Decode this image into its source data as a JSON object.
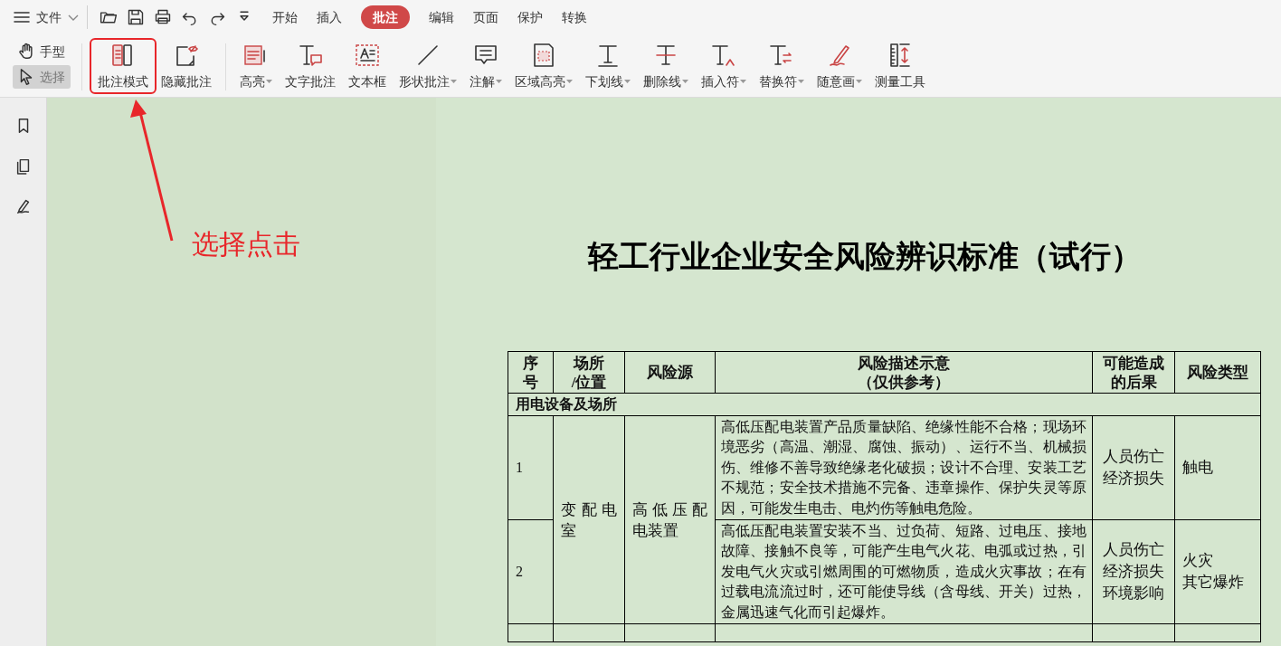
{
  "menu": {
    "label": "文件"
  },
  "tabs": [
    {
      "label": "开始",
      "selected": false
    },
    {
      "label": "插入",
      "selected": false
    },
    {
      "label": "批注",
      "selected": true
    },
    {
      "label": "编辑",
      "selected": false
    },
    {
      "label": "页面",
      "selected": false
    },
    {
      "label": "保护",
      "selected": false
    },
    {
      "label": "转换",
      "selected": false
    }
  ],
  "pointer_tools": [
    {
      "kind": "hand",
      "label": "手型",
      "selected": false
    },
    {
      "kind": "select",
      "label": "选择",
      "selected": true
    }
  ],
  "tools": [
    {
      "kind": "mode",
      "label": "批注模式",
      "dropdown": false,
      "outlined": true
    },
    {
      "kind": "hide",
      "label": "隐藏批注",
      "dropdown": false,
      "outlined": false
    },
    {
      "kind": "highlight",
      "label": "高亮",
      "dropdown": true,
      "outlined": false
    },
    {
      "kind": "textnote",
      "label": "文字批注",
      "dropdown": false,
      "outlined": false
    },
    {
      "kind": "textbox",
      "label": "文本框",
      "dropdown": false,
      "outlined": false
    },
    {
      "kind": "shape",
      "label": "形状批注",
      "dropdown": true,
      "outlined": false
    },
    {
      "kind": "note",
      "label": "注解",
      "dropdown": true,
      "outlined": false
    },
    {
      "kind": "area",
      "label": "区域高亮",
      "dropdown": true,
      "outlined": false
    },
    {
      "kind": "underline",
      "label": "下划线",
      "dropdown": true,
      "outlined": false
    },
    {
      "kind": "strike",
      "label": "删除线",
      "dropdown": true,
      "outlined": false
    },
    {
      "kind": "insert",
      "label": "插入符",
      "dropdown": true,
      "outlined": false
    },
    {
      "kind": "replace",
      "label": "替换符",
      "dropdown": true,
      "outlined": false
    },
    {
      "kind": "pen",
      "label": "随意画",
      "dropdown": true,
      "outlined": false
    },
    {
      "kind": "measure",
      "label": "测量工具",
      "dropdown": false,
      "outlined": false
    }
  ],
  "annotation": {
    "text": "选择点击"
  },
  "document": {
    "title": "轻工行业企业安全风险辨识标准（试行）",
    "table": {
      "columns": [
        [
          "序",
          "号"
        ],
        [
          "场所",
          "/位置"
        ],
        [
          "风险源"
        ],
        [
          "风险描述示意",
          "（仅供参考）"
        ],
        [
          "可能造成",
          "的后果"
        ],
        [
          "风险类型"
        ]
      ],
      "sections": [
        {
          "title": "用电设备及场所",
          "groups": [
            {
              "place": "变配电室",
              "source": "高低压配电装置",
              "items": [
                {
                  "no": "1",
                  "description": "高低压配电装置产品质量缺陷、绝缘性能不合格；现场环境恶劣（高温、潮湿、腐蚀、振动）、运行不当、机械损伤、维修不善导致绝缘老化破损；设计不合理、安装工艺不规范；安全技术措施不完备、违章操作、保护失灵等原因，可能发生电击、电灼伤等触电危险。",
                  "consequence": [
                    "人员伤亡",
                    "经济损失"
                  ],
                  "type": [
                    "触电"
                  ]
                },
                {
                  "no": "2",
                  "description": "高低压配电装置安装不当、过负荷、短路、过电压、接地故障、接触不良等，可能产生电气火花、电弧或过热，引发电气火灾或引燃周围的可燃物质，造成火灾事故；在有过载电流流过时，还可能使导线（含母线、开关）过热，金属迅速气化而引起爆炸。",
                  "consequence": [
                    "人员伤亡",
                    "经济损失",
                    "环境影响"
                  ],
                  "type": [
                    "火灾",
                    "其它爆炸"
                  ]
                }
              ]
            }
          ]
        }
      ]
    }
  }
}
